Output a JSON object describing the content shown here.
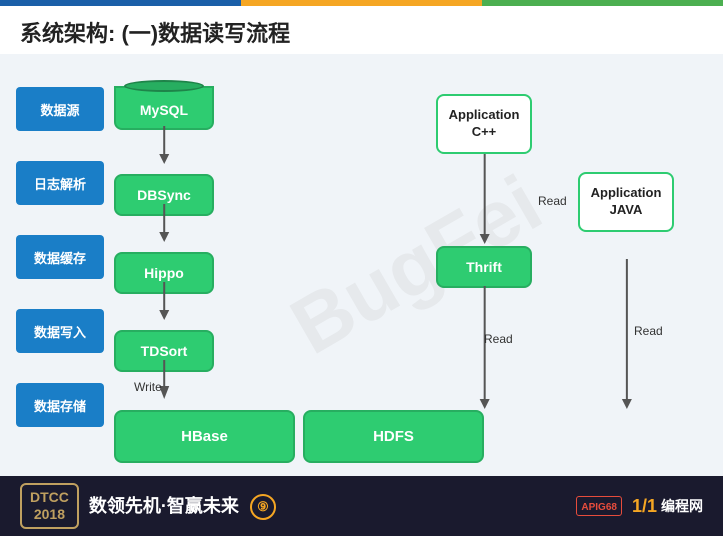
{
  "header": {
    "title": "系统架构: (一)数据读写流程"
  },
  "labels": [
    {
      "id": "datasource",
      "text": "数据源"
    },
    {
      "id": "log-parse",
      "text": "日志解析"
    },
    {
      "id": "data-cache",
      "text": "数据缓存"
    },
    {
      "id": "data-write",
      "text": "数据写入"
    },
    {
      "id": "data-store",
      "text": "数据存储"
    }
  ],
  "flow_nodes": [
    {
      "id": "mysql",
      "text": "MySQL"
    },
    {
      "id": "dbsync",
      "text": "DBSync"
    },
    {
      "id": "hippo",
      "text": "Hippo"
    },
    {
      "id": "tdsort",
      "text": "TDSort"
    }
  ],
  "bottom_nodes": [
    {
      "id": "hbase",
      "text": "HBase"
    },
    {
      "id": "hdfs",
      "text": "HDFS"
    }
  ],
  "app_nodes": [
    {
      "id": "app-cpp",
      "text": "Application\nC++"
    },
    {
      "id": "app-java",
      "text": "Application\nJAVA"
    }
  ],
  "thrift": {
    "id": "thrift",
    "text": "Thrift"
  },
  "labels_arrows": {
    "write": "Write",
    "read1": "Read",
    "read2": "Read",
    "read3": "Read"
  },
  "footer": {
    "dtcc_year": "DTCC",
    "dtcc_num": "2018",
    "slogan": "数领先机·智赢未来",
    "circle_icon": "⑨",
    "kpi_text": "APIGS...",
    "coding_icon": "1/1",
    "coding_text": "编程网"
  },
  "watermark": "BugFei"
}
